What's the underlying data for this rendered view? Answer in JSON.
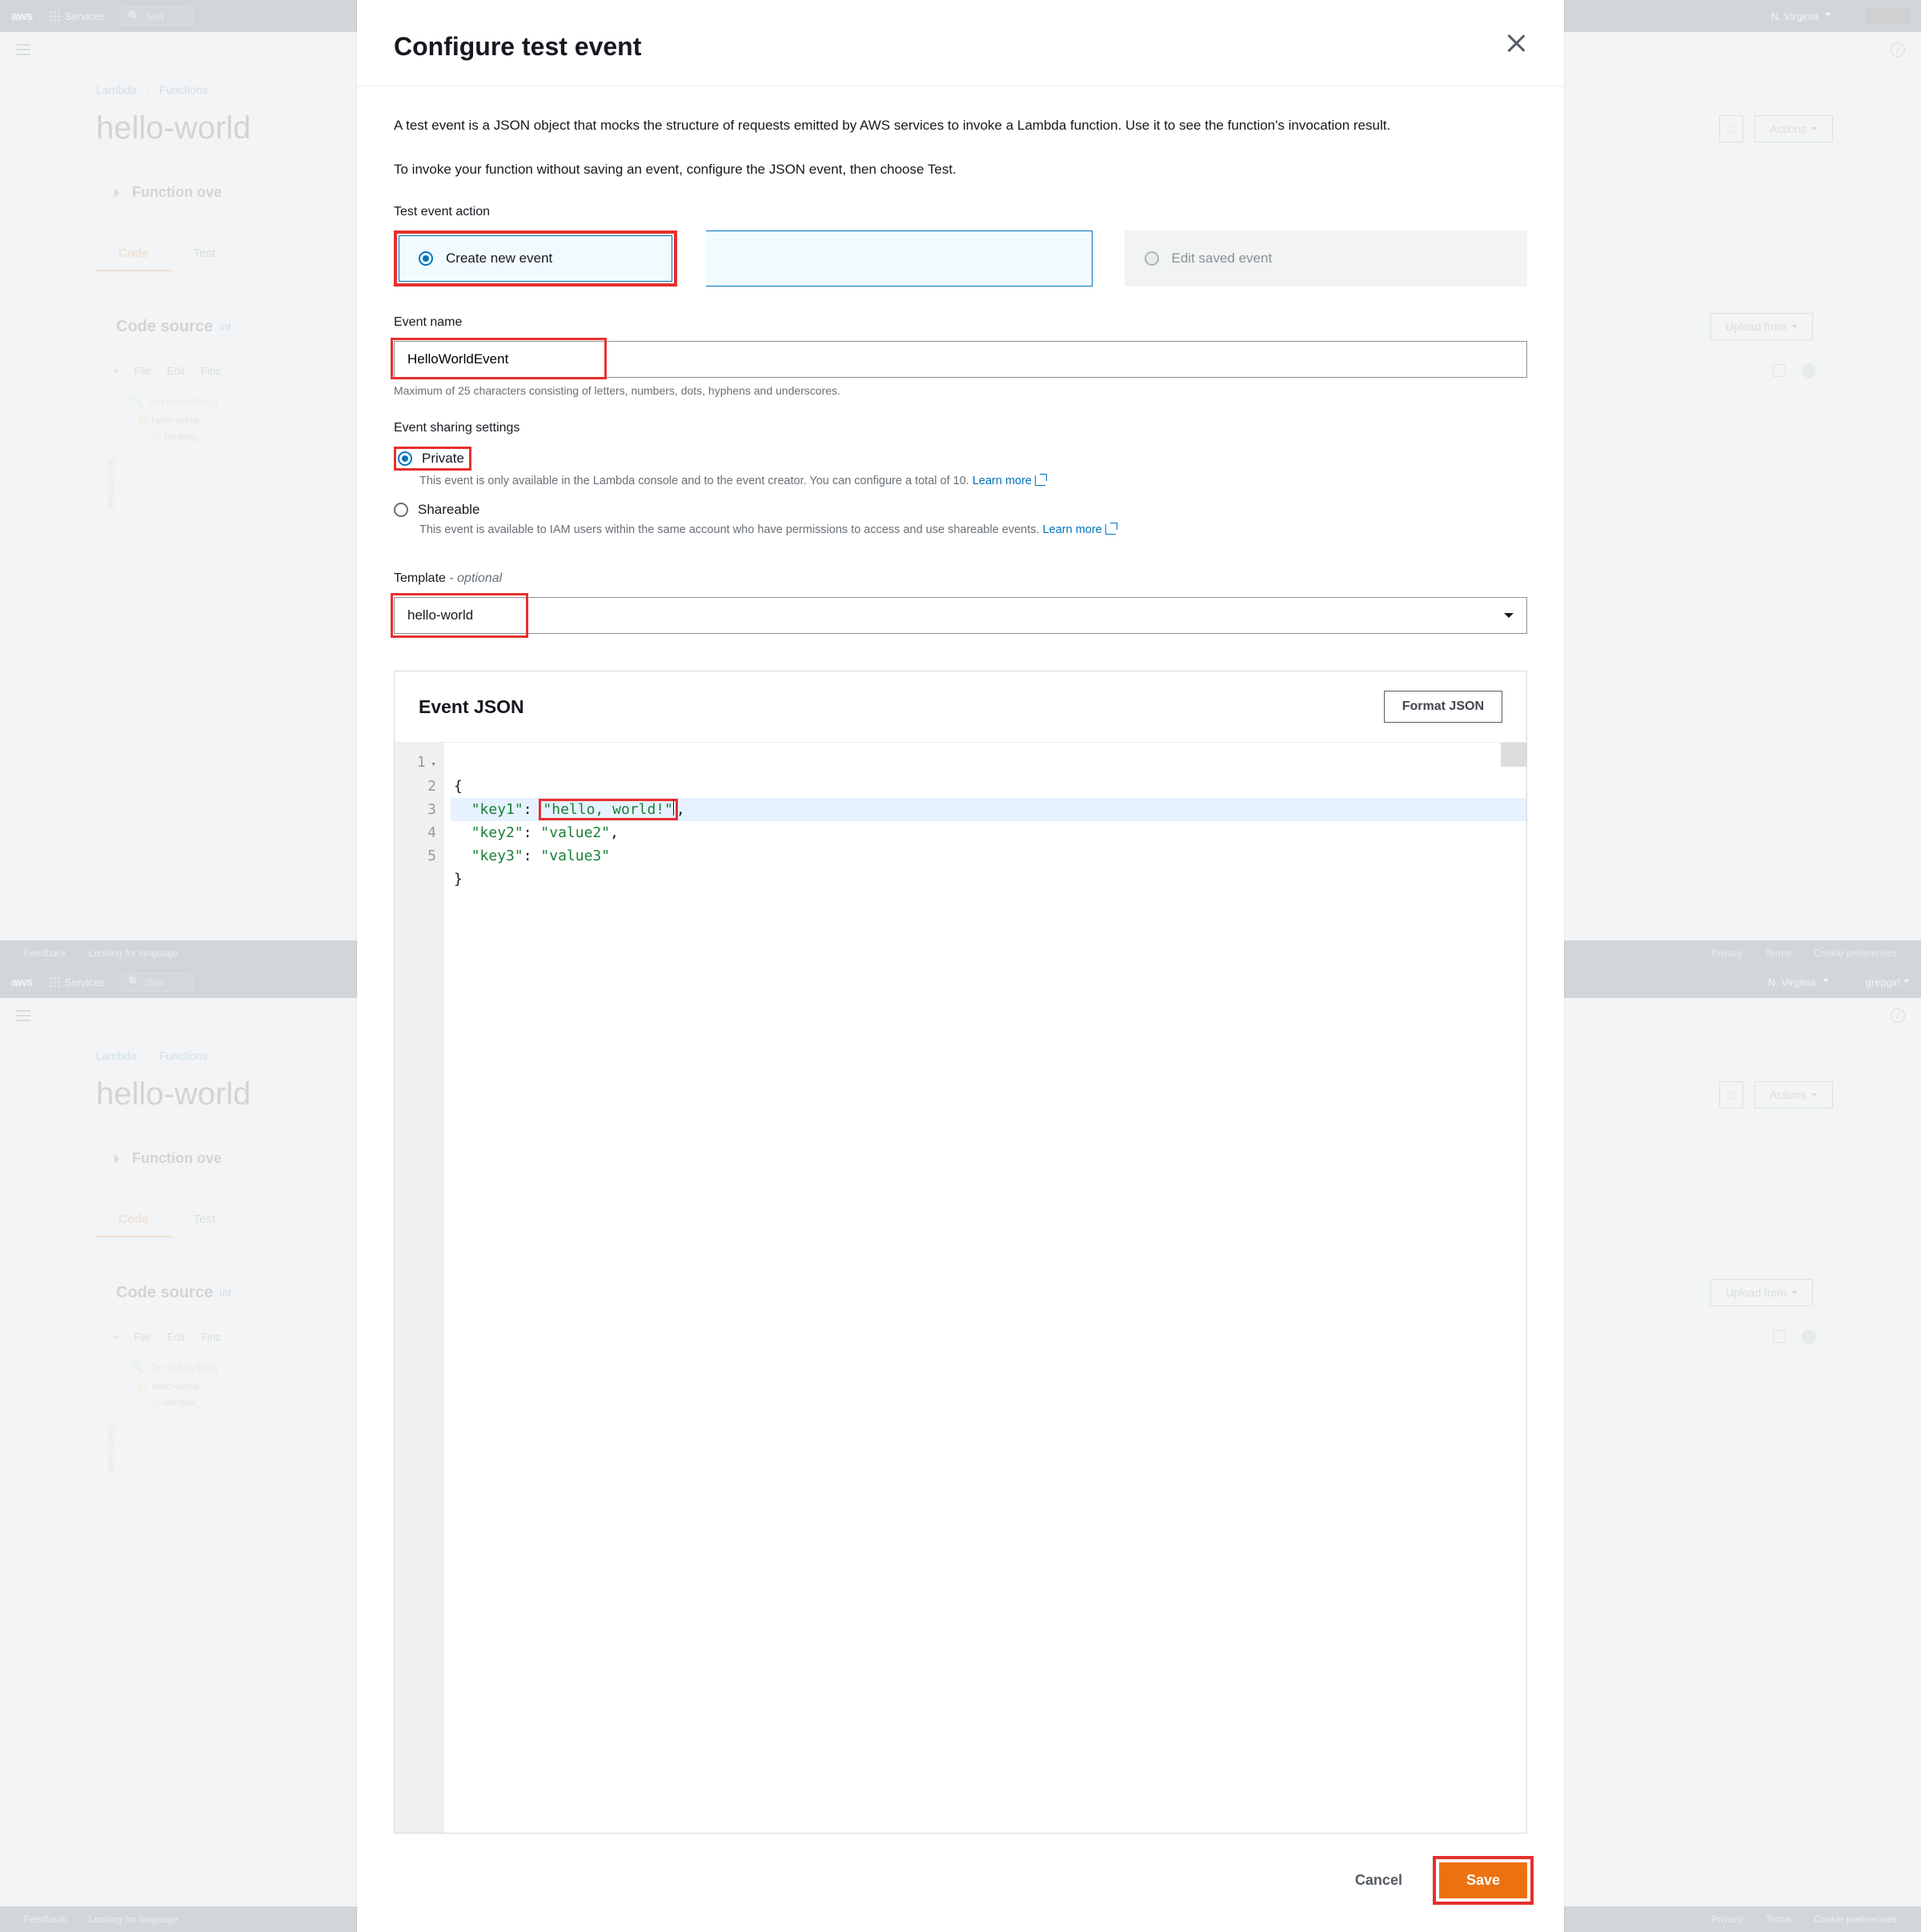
{
  "aws_header": {
    "logo": "aws",
    "services": "Services",
    "search_placeholder": "Sea",
    "region": "N. Virginia",
    "user_short": "grepgirl"
  },
  "breadcrumb": {
    "a": "Lambda",
    "b": "Functions"
  },
  "page_title": "hello-world",
  "buttons": {
    "actions": "Actions",
    "upload_from": "Upload from"
  },
  "panel": {
    "overview": "Function ove"
  },
  "tabs": {
    "code": "Code",
    "test": "Test"
  },
  "code_source": {
    "title": "Code source",
    "info": "Inf"
  },
  "ide": {
    "menu": {
      "file": "File",
      "edit": "Edit",
      "find": "Finc"
    },
    "search": "Go to Anything",
    "tree_folder": "hello-world-",
    "tree_file": "lambda_",
    "side_label": "Environment"
  },
  "footer": {
    "feedback": "Feedback",
    "lang": "Looking for language",
    "privacy": "Privacy",
    "terms": "Terms",
    "cookies": "Cookie preferences"
  },
  "modal": {
    "title": "Configure test event",
    "desc": "A test event is a JSON object that mocks the structure of requests emitted by AWS services to invoke a Lambda function. Use it to see the function's invocation result.",
    "desc2": "To invoke your function without saving an event, configure the JSON event, then choose Test.",
    "action_label": "Test event action",
    "create_new": "Create new event",
    "edit_saved": "Edit saved event",
    "eventname_label": "Event name",
    "eventname_value": "HelloWorldEvent",
    "eventname_help": "Maximum of 25 characters consisting of letters, numbers, dots, hyphens and underscores.",
    "sharing_label": "Event sharing settings",
    "private": "Private",
    "private_help": "This event is only available in the Lambda console and to the event creator. You can configure a total of 10.",
    "shareable": "Shareable",
    "shareable_help": "This event is available to IAM users within the same account who have permissions to access and use shareable events.",
    "learn_more": "Learn more",
    "template_label": "Template",
    "template_opt": "- optional",
    "template_value": "hello-world",
    "json_title": "Event JSON",
    "format_json": "Format JSON",
    "json_lines": {
      "l1": "{",
      "k1": "\"key1\"",
      "v1": "\"hello, world!\"",
      "k2": "\"key2\"",
      "v2": "\"value2\"",
      "k3": "\"key3\"",
      "v3": "\"value3\"",
      "l5": "}"
    },
    "cancel": "Cancel",
    "save": "Save"
  }
}
